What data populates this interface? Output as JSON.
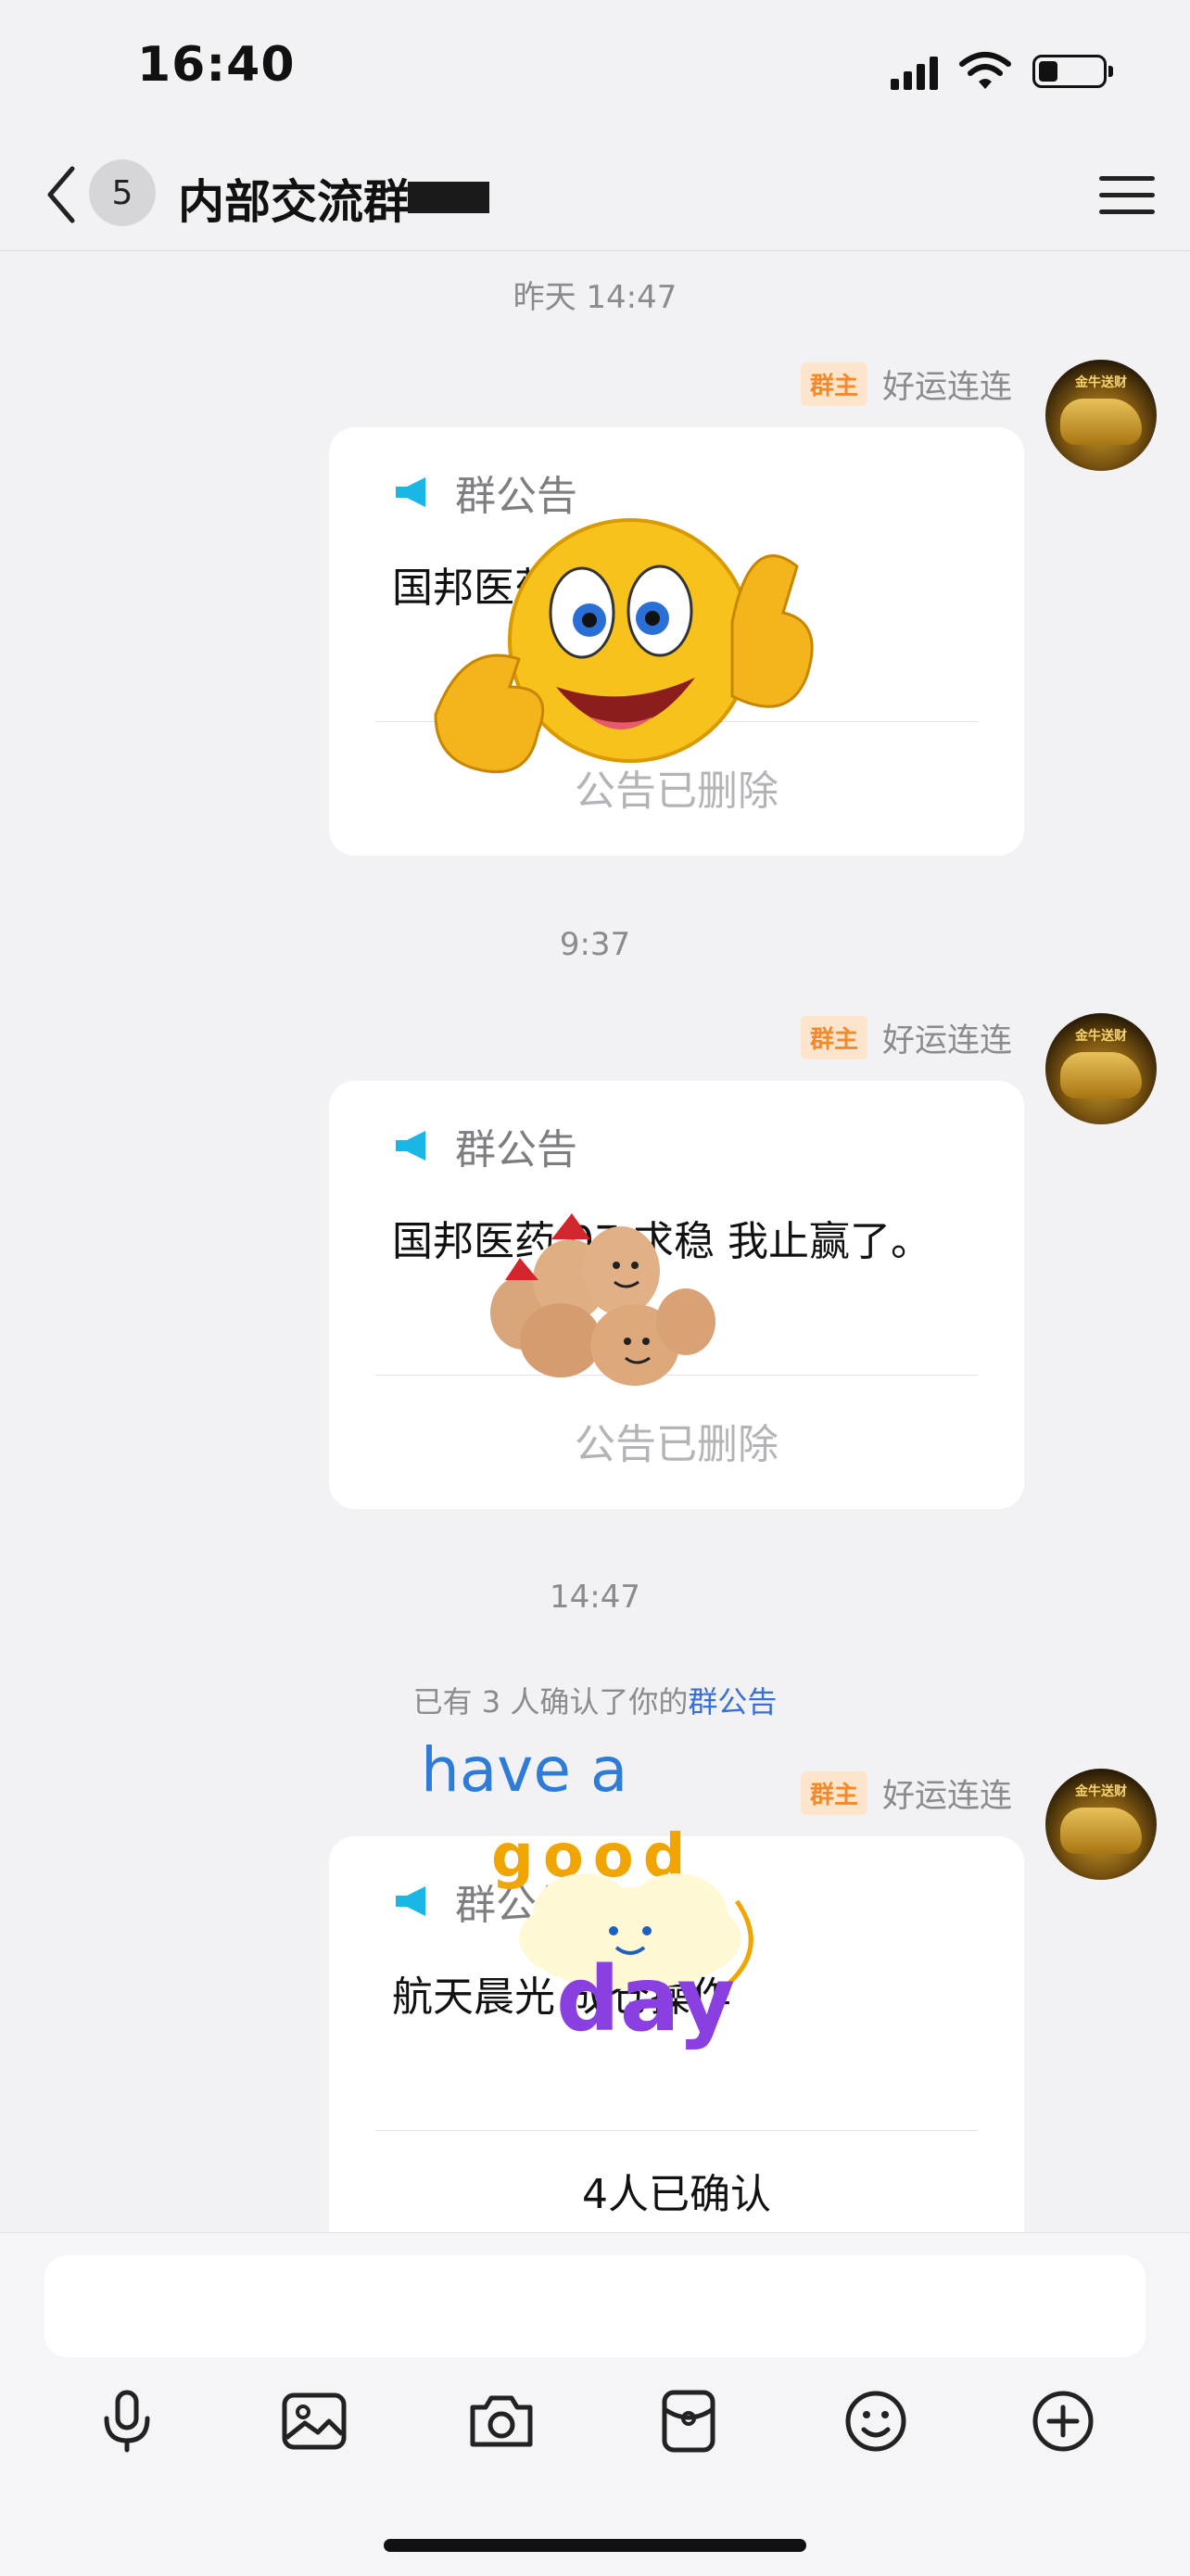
{
  "status_bar": {
    "time": "16:40",
    "battery_level": 0.3
  },
  "nav": {
    "back_badge": "5",
    "title": "内部交流群"
  },
  "messages": [
    {
      "timestamp": "昨天 14:47",
      "role_badge": "群主",
      "sender": "好运连连",
      "avatar_text": "金牛送财",
      "card_title": "群公告",
      "card_body": "国邦医药 成仓操作",
      "card_footer": "公告已删除"
    },
    {
      "timestamp": "9:37",
      "role_badge": "群主",
      "sender": "好运连连",
      "avatar_text": "金牛送财",
      "card_title": "群公告",
      "card_body": "国邦医药 07 求稳 我止赢了。",
      "card_footer": "公告已删除"
    },
    {
      "timestamp": "14:47",
      "system_prefix": "已有 3 人确认了你的",
      "system_link": "群公告",
      "role_badge": "群主",
      "sender": "好运连连",
      "avatar_text": "金牛送财",
      "card_title": "群公告",
      "card_body": "航天晨光 成仓操作",
      "card_footer": "4人已确认"
    }
  ],
  "stickers": {
    "good_day": {
      "line1": "have a",
      "line2": "good",
      "line3": "day"
    }
  },
  "toolbar": {
    "items": [
      "microphone-icon",
      "image-icon",
      "camera-icon",
      "red-packet-icon",
      "emoji-icon",
      "plus-icon"
    ]
  },
  "colors": {
    "accent": "#3a6fd8",
    "badge_bg": "#fde4cc",
    "badge_text": "#f08a2c",
    "background": "#f2f2f4"
  }
}
